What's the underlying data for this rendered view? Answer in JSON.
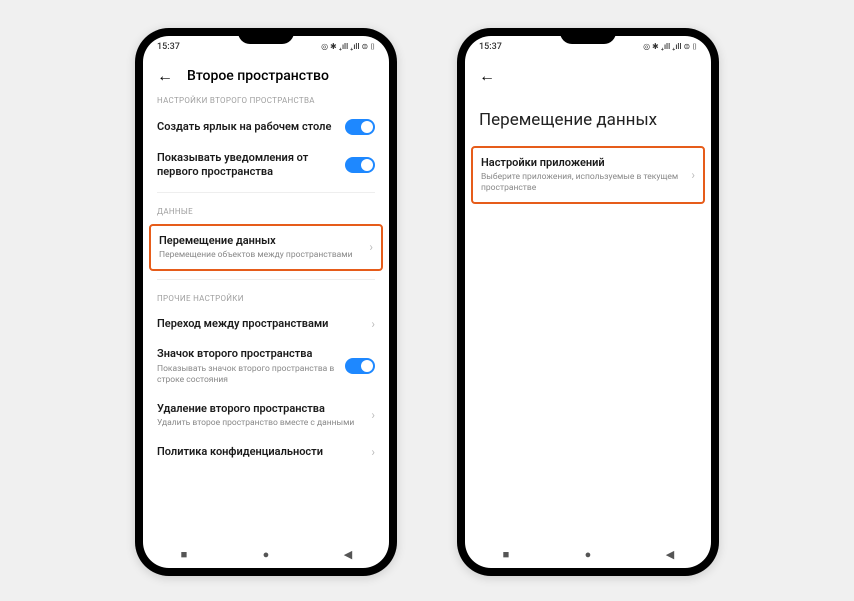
{
  "status": {
    "time": "15:37",
    "icons": "◎ ✱ ₊ıll ₊ıll ⊜ ⌷"
  },
  "p1": {
    "header_title": "Второе пространство",
    "section_header_top": "НАСТРОЙКИ ВТОРОГО ПРОСТРАНСТВА",
    "row_shortcut": {
      "title": "Создать ярлык на рабочем столе"
    },
    "row_notify": {
      "title": "Показывать уведомления от первого пространства"
    },
    "section_data": "ДАННЫЕ",
    "row_move": {
      "title": "Перемещение данных",
      "sub": "Перемещение объектов между пространствами"
    },
    "section_other": "ПРОЧИЕ НАСТРОЙКИ",
    "row_switch": {
      "title": "Переход между пространствами"
    },
    "row_icon2": {
      "title": "Значок второго пространства",
      "sub": "Показывать значок второго пространства в строке состояния"
    },
    "row_delete": {
      "title": "Удаление второго пространства",
      "sub": "Удалить второе пространство вместе с данными"
    },
    "row_privacy": {
      "title": "Политика конфиденциальности"
    }
  },
  "p2": {
    "big_title": "Перемещение данных",
    "row_apps": {
      "title": "Настройки приложений",
      "sub": "Выберите приложения, используемые в текущем пространстве"
    }
  }
}
